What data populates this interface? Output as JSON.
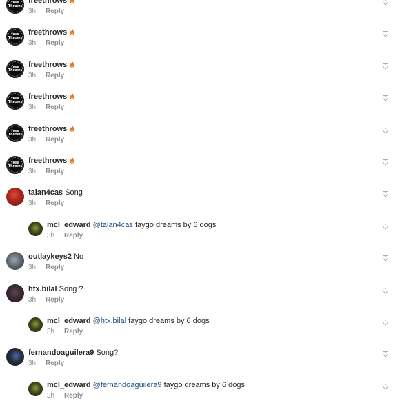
{
  "comments": [
    {
      "kind": "top",
      "avatar": "freethrows-logo",
      "avatar_text": [
        "free",
        "Throws"
      ],
      "username": "freethrows",
      "mention": "",
      "text": "",
      "emoji": "fire",
      "time": "3h",
      "reply_label": "Reply"
    },
    {
      "kind": "top",
      "avatar": "freethrows-logo",
      "avatar_text": [
        "free",
        "Throws"
      ],
      "username": "freethrows",
      "mention": "",
      "text": "",
      "emoji": "fire",
      "time": "3h",
      "reply_label": "Reply"
    },
    {
      "kind": "top",
      "avatar": "freethrows-logo",
      "avatar_text": [
        "free",
        "Throws"
      ],
      "username": "freethrows",
      "mention": "",
      "text": "",
      "emoji": "fire",
      "time": "3h",
      "reply_label": "Reply"
    },
    {
      "kind": "top",
      "avatar": "freethrows-logo",
      "avatar_text": [
        "free",
        "Throws"
      ],
      "username": "freethrows",
      "mention": "",
      "text": "",
      "emoji": "fire",
      "time": "3h",
      "reply_label": "Reply"
    },
    {
      "kind": "top",
      "avatar": "freethrows-logo",
      "avatar_text": [
        "free",
        "Throws"
      ],
      "username": "freethrows",
      "mention": "",
      "text": "",
      "emoji": "fire",
      "time": "3h",
      "reply_label": "Reply"
    },
    {
      "kind": "top",
      "avatar": "freethrows-logo",
      "avatar_text": [
        "free",
        "Throws"
      ],
      "username": "freethrows",
      "mention": "",
      "text": "",
      "emoji": "fire",
      "time": "3h",
      "reply_label": "Reply"
    },
    {
      "kind": "top",
      "avatar": "talan4cas-photo",
      "username": "talan4cas",
      "mention": "",
      "text": "Song",
      "emoji": "",
      "time": "3h",
      "reply_label": "Reply"
    },
    {
      "kind": "reply",
      "avatar": "mcl-edward-photo",
      "username": "mcl_edward",
      "mention": "@talan4cas",
      "text": "faygo dreams by 6 dogs",
      "emoji": "",
      "time": "3h",
      "reply_label": "Reply"
    },
    {
      "kind": "top",
      "avatar": "outlaykeys2-photo",
      "username": "outlaykeys2",
      "mention": "",
      "text": "No",
      "emoji": "",
      "time": "3h",
      "reply_label": "Reply"
    },
    {
      "kind": "top",
      "avatar": "htx-bilal-photo",
      "username": "htx.bilal",
      "mention": "",
      "text": "Song ?",
      "emoji": "",
      "time": "3h",
      "reply_label": "Reply"
    },
    {
      "kind": "reply",
      "avatar": "mcl-edward-photo",
      "username": "mcl_edward",
      "mention": "@htx.bilal",
      "text": "faygo dreams by 6 dogs",
      "emoji": "",
      "time": "3h",
      "reply_label": "Reply"
    },
    {
      "kind": "top",
      "avatar": "fernandoaguilera9-photo",
      "username": "fernandoaguilera9",
      "mention": "",
      "text": "Song?",
      "emoji": "",
      "time": "3h",
      "reply_label": "Reply"
    },
    {
      "kind": "reply",
      "avatar": "mcl-edward-photo",
      "username": "mcl_edward",
      "mention": "@fernandoaguilera9",
      "text": "faygo dreams by 6 dogs",
      "emoji": "",
      "time": "3h",
      "reply_label": "Reply"
    }
  ],
  "icons": {
    "like": "heart-outline-icon",
    "fire": "fire-emoji-icon"
  },
  "colors": {
    "username": "#262626",
    "mention": "#1f4f82",
    "meta": "#8e8e8e",
    "heart": "#9a9a9a",
    "fire": "#e8742a"
  }
}
